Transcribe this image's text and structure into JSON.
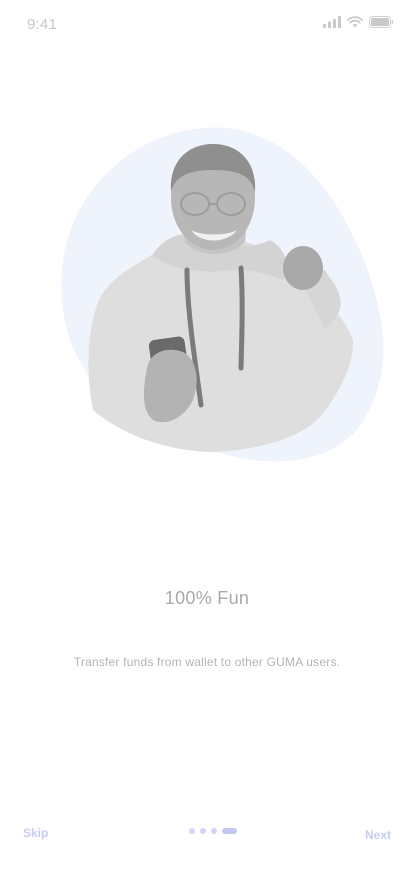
{
  "status_bar": {
    "time": "9:41",
    "icons": [
      "cellular-signal-icon",
      "wifi-icon",
      "battery-icon"
    ]
  },
  "onboarding": {
    "illustration": "man-celebrating-with-phone",
    "title": "100% Fun",
    "description": "Transfer funds from wallet to other GUMA users.",
    "page_index": 4,
    "page_count": 4
  },
  "navigation": {
    "skip_label": "Skip",
    "next_label": "Next"
  },
  "colors": {
    "accent": "#c2c7f0",
    "blob": "#eef2fb",
    "title_text": "#a9a9a9",
    "body_text": "#b4b4b4"
  }
}
